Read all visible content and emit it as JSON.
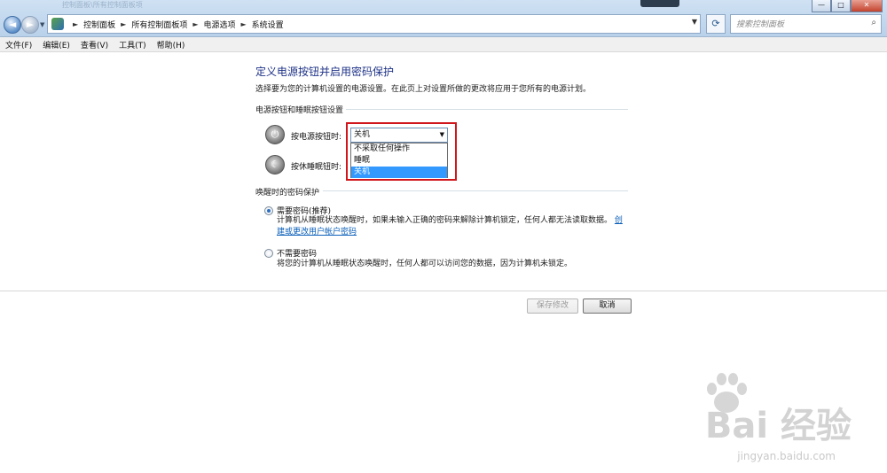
{
  "window": {
    "faint_title": "控制面板\\所有控制面板项",
    "minimize": "—",
    "maximize": "□",
    "close": "✕"
  },
  "address": {
    "crumbs": [
      "控制面板",
      "所有控制面板项",
      "电源选项",
      "系统设置"
    ],
    "search_placeholder": "搜索控制面板"
  },
  "menu": [
    "文件(F)",
    "编辑(E)",
    "查看(V)",
    "工具(T)",
    "帮助(H)"
  ],
  "page": {
    "title": "定义电源按钮并启用密码保护",
    "description": "选择要为您的计算机设置的电源设置。在此页上对设置所做的更改将应用于您所有的电源计划。"
  },
  "power_section": {
    "heading": "电源按钮和睡眠按钮设置",
    "power_button_label": "按电源按钮时:",
    "sleep_button_label": "按休睡眠钮时:",
    "combo_value": "关机",
    "options": [
      "不采取任何操作",
      "睡眠",
      "关机"
    ],
    "selected_option": "关机"
  },
  "password_section": {
    "heading": "唤醒时的密码保护",
    "require_title": "需要密码(推荐)",
    "require_desc_line1": "计算机从睡眠状态唤醒时，如果未输入正确的密码来解除计算机锁定，任何人都无法读取数据。",
    "require_link_part1": "创",
    "require_link_part2": "建或更改用户帐户密码",
    "no_require_title": "不需要密码",
    "no_require_desc": "将您的计算机从睡眠状态唤醒时，任何人都可以访问您的数据，因为计算机未锁定。",
    "require_selected": true
  },
  "buttons": {
    "save": "保存修改",
    "cancel": "取消"
  },
  "watermark": {
    "logo": "Bai 经验",
    "url": "jingyan.baidu.com"
  }
}
